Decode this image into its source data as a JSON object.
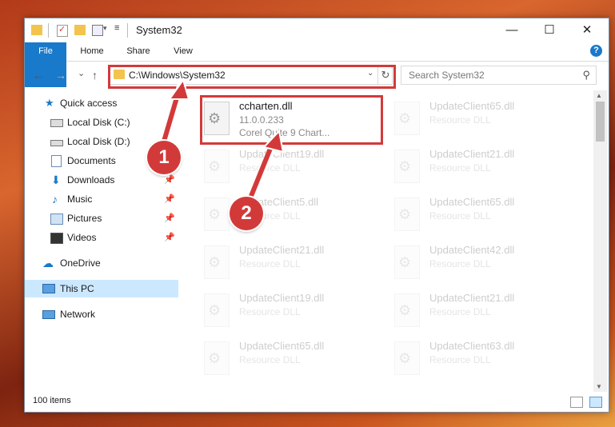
{
  "window": {
    "title": "System32"
  },
  "controls": {
    "minimize": "—",
    "maximize": "☐",
    "close": "✕"
  },
  "ribbon": {
    "file": "File",
    "home": "Home",
    "share": "Share",
    "view": "View",
    "help": "?"
  },
  "nav": {
    "back": "←",
    "forward": "→",
    "recent": "⌄",
    "up": "↑"
  },
  "address": {
    "path": "C:\\Windows\\System32"
  },
  "search": {
    "placeholder": "Search System32"
  },
  "sidebar": {
    "items": [
      {
        "label": "Quick access",
        "icon": "star-icon"
      },
      {
        "label": "Local Disk (C:)",
        "icon": "drive-icon"
      },
      {
        "label": "Local Disk (D:)",
        "icon": "drive-icon"
      },
      {
        "label": "Documents",
        "icon": "documents-icon"
      },
      {
        "label": "Downloads",
        "icon": "download-icon",
        "pinned": true
      },
      {
        "label": "Music",
        "icon": "music-icon",
        "pinned": true
      },
      {
        "label": "Pictures",
        "icon": "pictures-icon",
        "pinned": true
      },
      {
        "label": "Videos",
        "icon": "videos-icon",
        "pinned": true
      },
      {
        "label": "OneDrive",
        "icon": "cloud-icon"
      },
      {
        "label": "This PC",
        "icon": "pc-icon",
        "selected": true
      },
      {
        "label": "Network",
        "icon": "network-icon"
      }
    ]
  },
  "files": [
    {
      "name": "ccharten.dll",
      "line2": "11.0.0.233",
      "line3": "Corel Quite 9 Chart..."
    },
    {
      "name": "UpdateClient65.dll",
      "line2": "Resource DLL"
    },
    {
      "name": "UpdateClient19.dll",
      "line2": "Resource DLL"
    },
    {
      "name": "UpdateClient21.dll",
      "line2": "Resource DLL"
    },
    {
      "name": "UpdateClient5.dll",
      "line2": "Resource DLL"
    },
    {
      "name": "UpdateClient65.dll",
      "line2": "Resource DLL"
    },
    {
      "name": "UpdateClient21.dll",
      "line2": "Resource DLL"
    },
    {
      "name": "UpdateClient42.dll",
      "line2": "Resource DLL"
    },
    {
      "name": "UpdateClient19.dll",
      "line2": "Resource DLL"
    },
    {
      "name": "UpdateClient21.dll",
      "line2": "Resource DLL"
    },
    {
      "name": "UpdateClient65.dll",
      "line2": "Resource DLL"
    },
    {
      "name": "UpdateClient63.dll",
      "line2": "Resource DLL"
    }
  ],
  "status": {
    "count": "100 items"
  },
  "callouts": {
    "one": "1",
    "two": "2"
  },
  "colors": {
    "accent": "#1979ca",
    "highlight": "#d23a3a"
  }
}
